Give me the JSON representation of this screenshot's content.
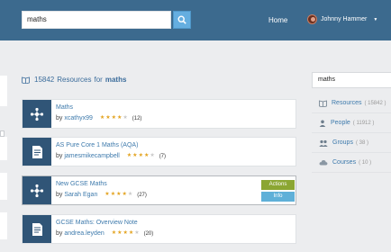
{
  "search": {
    "value": "maths"
  },
  "header": {
    "home_label": "Home",
    "user_name": "Johnny Hammer"
  },
  "results": {
    "count": "15842",
    "resources_label": "Resources",
    "for_label": "for",
    "query": "maths"
  },
  "cards": [
    {
      "title": "Maths",
      "by": "by",
      "author": "xcathyx99",
      "votes": "(12)",
      "rating": 4.5,
      "icon": "network-icon"
    },
    {
      "title": "AS Pure Core 1 Maths (AQA)",
      "by": "by",
      "author": "jamesmikecampbell",
      "votes": "(7)",
      "rating": 4.5,
      "icon": "document-icon"
    },
    {
      "title": "New GCSE Maths",
      "by": "by",
      "author": "Sarah Egan",
      "votes": "(27)",
      "rating": 4.5,
      "icon": "network-icon",
      "actions_label": "Actions",
      "info_label": "Info"
    },
    {
      "title": "GCSE Maths: Overview Note",
      "by": "by",
      "author": "andrea.leyden",
      "votes": "(20)",
      "rating": 4.5,
      "icon": "document-icon"
    }
  ],
  "sidebar": {
    "search_value": "maths",
    "items": [
      {
        "label": "Resources",
        "count": "( 15842 )",
        "icon": "book-icon"
      },
      {
        "label": "People",
        "count": "( 11912 )",
        "icon": "person-icon"
      },
      {
        "label": "Groups",
        "count": "( 38 )",
        "icon": "group-icon"
      },
      {
        "label": "Courses",
        "count": "( 10 )",
        "icon": "cloud-icon"
      }
    ]
  },
  "colors": {
    "header": "#3c6a8e",
    "search_button": "#65aee0",
    "card_icon_bg": "#305577",
    "link": "#3e7aac",
    "actions": "#8ba632",
    "info": "#5fb0d8",
    "star": "#e3a31f"
  }
}
